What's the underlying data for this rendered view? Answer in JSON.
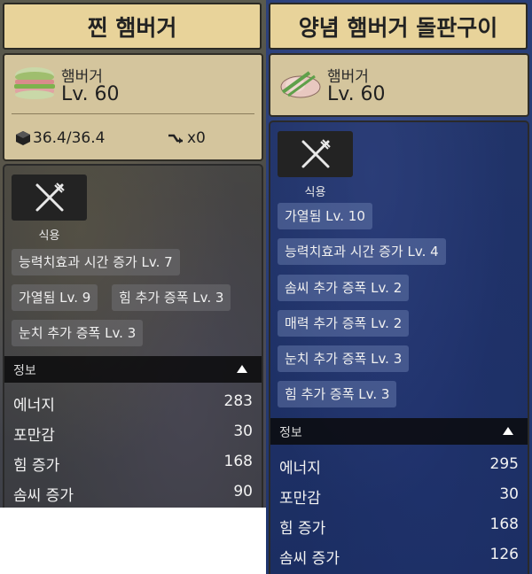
{
  "left_card": {
    "title": "찐 햄버거",
    "item_name": "햄버거",
    "level": "Lv. 60",
    "weight": "36.4/36.4",
    "count": "x0",
    "eat_label": "식용",
    "tags": [
      "능력치효과 시간 증가  Lv. 7",
      "가열됨 Lv. 9",
      "힘 추가 증폭 Lv. 3",
      "눈치 추가 증폭 Lv. 3"
    ],
    "info_label": "정보",
    "stats": [
      {
        "key": "에너지",
        "value": "283"
      },
      {
        "key": "포만감",
        "value": "30"
      },
      {
        "key": "힘 증가",
        "value": "168"
      },
      {
        "key": "솜씨 증가",
        "value": "90"
      }
    ]
  },
  "right_card": {
    "title": "양념 햄버거 돌판구이",
    "item_name": "햄버거",
    "level": "Lv. 60",
    "eat_label": "식용",
    "tags": [
      "가열됨 Lv. 10",
      "능력치효과 시간 증가  Lv. 4",
      "솜씨 추가 증폭 Lv. 2",
      "매력 추가 증폭 Lv. 2",
      "눈치 추가 증폭 Lv. 3",
      "힘 추가 증폭 Lv. 3"
    ],
    "info_label": "정보",
    "stats": [
      {
        "key": "에너지",
        "value": "295"
      },
      {
        "key": "포만감",
        "value": "30"
      },
      {
        "key": "힘 증가",
        "value": "168"
      },
      {
        "key": "솜씨 증가",
        "value": "126"
      }
    ]
  },
  "colors": {
    "title_bg": "#e8d39a",
    "header_bg": "#d4c59d",
    "left_bg": "#4b4a46",
    "right_bg": "#253a74"
  },
  "icons": [
    "burger-icon",
    "grilled-burger-icon",
    "cube-icon",
    "swap-icon",
    "fork-knife-icon",
    "caret-up-icon"
  ]
}
